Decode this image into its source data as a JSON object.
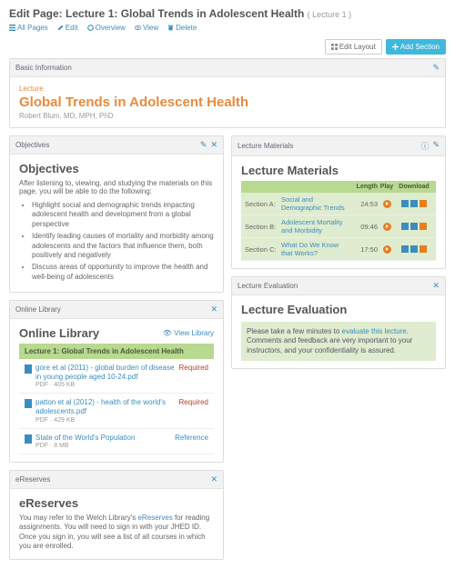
{
  "header": {
    "title": "Edit Page: Lecture 1: Global Trends in Adolescent Health",
    "subtitle": "( Lecture 1 )",
    "actions": {
      "all_pages": "All Pages",
      "edit": "Edit",
      "overview": "Overview",
      "view": "View",
      "delete": "Delete"
    }
  },
  "top_buttons": {
    "edit_layout": "Edit Layout",
    "add_section": "Add Section"
  },
  "basic_info": {
    "header": "Basic Information",
    "type": "Lecture",
    "title": "Global Trends in Adolescent Health",
    "author": "Robert Blum, MD, MPH, PhD"
  },
  "objectives": {
    "header": "Objectives",
    "title": "Objectives",
    "intro": "After listening to, viewing, and studying the materials on this page, you will be able to do the following:",
    "items": [
      "Highlight social and demographic trends impacting adolescent health and development from a global perspective",
      "Identify leading causes of mortality and morbidity among adolescents and the factors that influence them, both positively and negatively",
      "Discuss areas of opportunity to improve the health and well-being of adolescents"
    ]
  },
  "library": {
    "header": "Online Library",
    "title": "Online Library",
    "view_link": "View Library",
    "group": "Lecture 1: Global Trends in Adolescent Health",
    "items": [
      {
        "title": "gore et al (2011) - global burden of disease in young people aged 10-24.pdf",
        "meta": "PDF · 405 KB",
        "tag": "Required",
        "tag_class": "tag-required"
      },
      {
        "title": "patton et al (2012) - health of the world's adolescents.pdf",
        "meta": "PDF · 429 KB",
        "tag": "Required",
        "tag_class": "tag-required"
      },
      {
        "title": "State of the World's Population",
        "meta": "PDF · 8 MB",
        "tag": "Reference",
        "tag_class": "tag-reference"
      }
    ]
  },
  "ereserves": {
    "header": "eReserves",
    "title": "eReserves",
    "text_before": "You may refer to the Welch Library's ",
    "link": "eReserves",
    "text_after": " for reading assignments. You will need to sign in with your JHED ID. Once you sign in, you will see a list of all courses in which you are enrolled."
  },
  "materials": {
    "header": "Lecture Materials",
    "title": "Lecture Materials",
    "columns": {
      "length": "Length",
      "play": "Play",
      "download": "Download"
    },
    "rows": [
      {
        "section": "Section A:",
        "title": "Social and Demographic Trends",
        "length": "24:53"
      },
      {
        "section": "Section B:",
        "title": "Adolescent Mortality and Morbidity",
        "length": "09:46"
      },
      {
        "section": "Section C:",
        "title": "What Do We Know that Works?",
        "length": "17:50"
      }
    ]
  },
  "evaluation": {
    "header": "Lecture Evaluation",
    "title": "Lecture Evaluation",
    "text_before": "Please take a few minutes to ",
    "link": "evaluate this lecture",
    "text_after": ". Comments and feedback are very important to your instructors, and your confidentiality is assured."
  }
}
